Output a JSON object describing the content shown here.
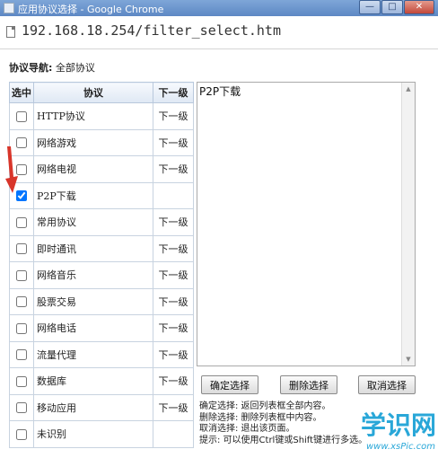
{
  "window": {
    "title": "应用协议选择 - Google Chrome",
    "controls": {
      "minimize": "—",
      "maximize": "□",
      "close": "✕"
    }
  },
  "address": {
    "url": "192.168.18.254/filter_select.htm"
  },
  "nav": {
    "label": "协议导航:",
    "value": "全部协议"
  },
  "table": {
    "headers": {
      "select": "选中",
      "protocol": "协议",
      "next": "下一级"
    },
    "rows": [
      {
        "name": "HTTP协议",
        "next": "下一级",
        "checked": false
      },
      {
        "name": "网络游戏",
        "next": "下一级",
        "checked": false
      },
      {
        "name": "网络电视",
        "next": "下一级",
        "checked": false
      },
      {
        "name": "P2P下载",
        "next": "",
        "checked": true
      },
      {
        "name": "常用协议",
        "next": "下一级",
        "checked": false
      },
      {
        "name": "即时通讯",
        "next": "下一级",
        "checked": false
      },
      {
        "name": "网络音乐",
        "next": "下一级",
        "checked": false
      },
      {
        "name": "股票交易",
        "next": "下一级",
        "checked": false
      },
      {
        "name": "网络电话",
        "next": "下一级",
        "checked": false
      },
      {
        "name": "流量代理",
        "next": "下一级",
        "checked": false
      },
      {
        "name": "数据库",
        "next": "下一级",
        "checked": false
      },
      {
        "name": "移动应用",
        "next": "下一级",
        "checked": false
      },
      {
        "name": "未识别",
        "next": "",
        "checked": false
      }
    ]
  },
  "result": {
    "items": [
      "P2P下载"
    ]
  },
  "buttons": {
    "confirm": "确定选择",
    "delete": "删除选择",
    "cancel": "取消选择"
  },
  "help": {
    "line1": "确定选择: 返回列表框全部内容。",
    "line2": "删除选择: 删除列表框中内容。",
    "line3": "取消选择: 退出该页面。",
    "line4": "提示: 可以使用Ctrl键或Shift键进行多选。"
  },
  "watermark": {
    "text": "学识网",
    "url": "www.xsPic.com"
  },
  "colors": {
    "arrow": "#d8352a",
    "header_bg": "#dfe8f4",
    "watermark": "#29a7d8"
  }
}
